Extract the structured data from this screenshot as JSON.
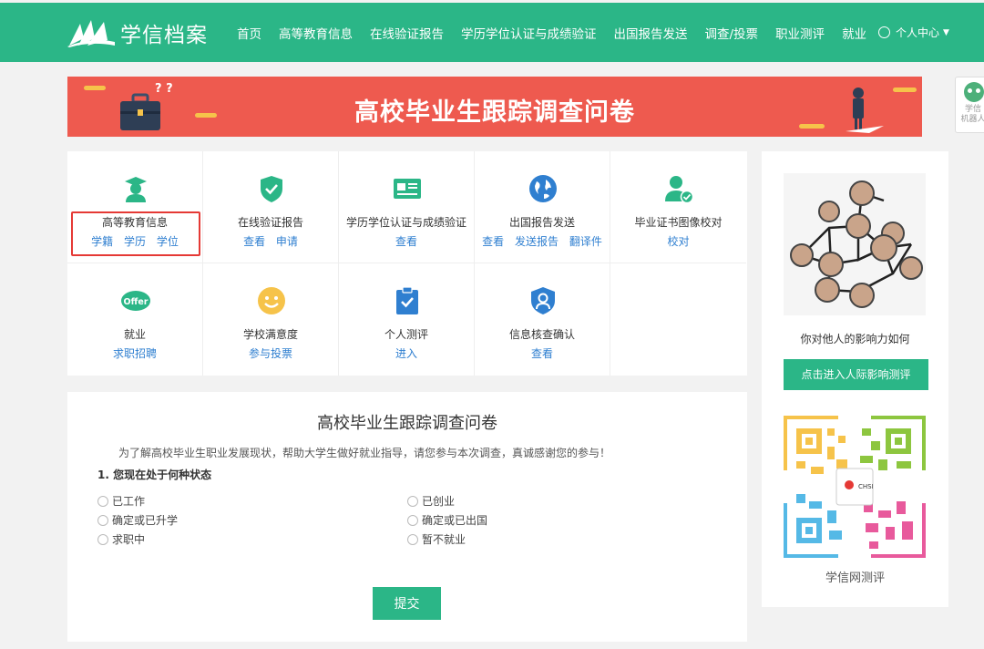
{
  "header": {
    "logo_text": "学信档案",
    "nav": [
      "首页",
      "高等教育信息",
      "在线验证报告",
      "学历学位认证与成绩验证",
      "出国报告发送",
      "调查/投票",
      "职业测评",
      "就业"
    ],
    "user_center": "个人中心"
  },
  "banner": {
    "title": "高校毕业生跟踪调查问卷"
  },
  "robot": {
    "label_1": "学信",
    "label_2": "机器人"
  },
  "services": [
    {
      "title": "高等教育信息",
      "links": [
        "学籍",
        "学历",
        "学位"
      ],
      "icon": "graduate-icon"
    },
    {
      "title": "在线验证报告",
      "links": [
        "查看",
        "申请"
      ],
      "icon": "shield-check-icon"
    },
    {
      "title": "学历学位认证与成绩验证",
      "links": [
        "查看"
      ],
      "icon": "certificate-icon"
    },
    {
      "title": "出国报告发送",
      "links": [
        "查看",
        "发送报告",
        "翻译件"
      ],
      "icon": "globe-icon"
    },
    {
      "title": "毕业证书图像校对",
      "links": [
        "校对"
      ],
      "icon": "user-check-icon"
    },
    {
      "title": "就业",
      "links": [
        "求职招聘"
      ],
      "icon": "offer-icon"
    },
    {
      "title": "学校满意度",
      "links": [
        "参与投票"
      ],
      "icon": "smile-icon"
    },
    {
      "title": "个人测评",
      "links": [
        "进入"
      ],
      "icon": "clipboard-check-icon"
    },
    {
      "title": "信息核查确认",
      "links": [
        "查看"
      ],
      "icon": "user-shield-icon"
    }
  ],
  "survey": {
    "title": "高校毕业生跟踪调查问卷",
    "intro": "为了解高校毕业生职业发展现状，帮助大学生做好就业指导，请您参与本次调查，真诚感谢您的参与！",
    "question": "1. 您现在处于何种状态",
    "options": [
      "已工作",
      "已创业",
      "确定或已升学",
      "确定或已出国",
      "求职中",
      "暂不就业"
    ],
    "submit": "提交"
  },
  "side": {
    "caption": "你对他人的影响力如何",
    "button": "点击进入人际影响测评",
    "qr_caption": "学信网测评",
    "qr_brand": "CHSI"
  },
  "colors": {
    "brand_green": "#2bb687",
    "banner_red": "#ee5a4f",
    "link_blue": "#2f7fd0",
    "highlight_red": "#e53935"
  }
}
